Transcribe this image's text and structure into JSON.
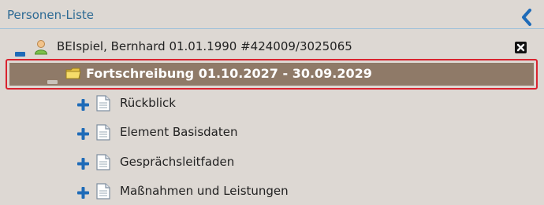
{
  "header": {
    "title": "Personen-Liste",
    "collapse_icon": "chevron-left-icon"
  },
  "colors": {
    "header_text": "#2d6a94",
    "accent_blue": "#1e6bb8",
    "selected_bg": "#8f7a68",
    "selected_border": "#d9232f",
    "panel_bg": "#ddd8d3"
  },
  "tree": {
    "person": {
      "label": "BEIspiel, Bernhard 01.01.1990 #424009/3025065",
      "toggle": "minus",
      "icon": "person-icon",
      "close_icon": "close-icon"
    },
    "selected": {
      "label": "Fortschreibung 01.10.2027 - 30.09.2029",
      "toggle": "minus",
      "icon": "folder-icon"
    },
    "children": [
      {
        "label": "Rückblick",
        "toggle": "plus",
        "icon": "document-icon"
      },
      {
        "label": "Element Basisdaten",
        "toggle": "plus",
        "icon": "document-icon"
      },
      {
        "label": "Gesprächsleitfaden",
        "toggle": "plus",
        "icon": "document-icon"
      },
      {
        "label": "Maßnahmen und Leistungen",
        "toggle": "plus",
        "icon": "document-icon"
      }
    ]
  }
}
